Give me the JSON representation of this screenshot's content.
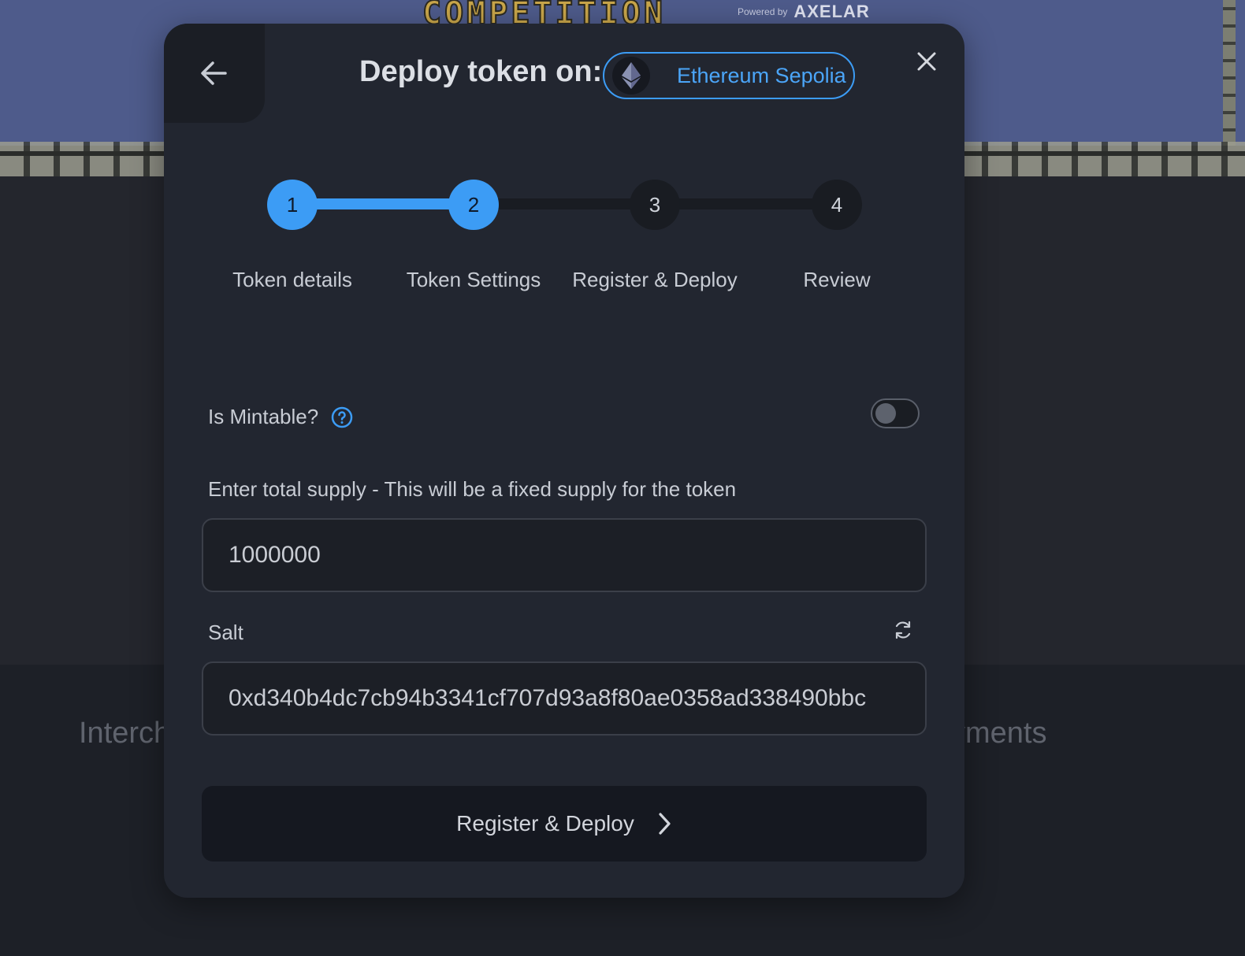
{
  "background": {
    "banner_title": "COMPETITION",
    "powered_by": "Powered by",
    "powered_brand": "AXELAR",
    "left_text": "Interch",
    "right_text": "yments"
  },
  "modal": {
    "title": "Deploy token on:",
    "chain": {
      "name": "Ethereum Sepolia",
      "icon": "ethereum-icon"
    },
    "steps": [
      {
        "number": "1",
        "label": "Token details",
        "state": "complete"
      },
      {
        "number": "2",
        "label": "Token Settings",
        "state": "current"
      },
      {
        "number": "3",
        "label": "Register & Deploy",
        "state": "pending"
      },
      {
        "number": "4",
        "label": "Review",
        "state": "pending"
      }
    ],
    "mintable": {
      "label": "Is Mintable?",
      "enabled": false
    },
    "supply": {
      "label": "Enter total supply - This will be a fixed supply for the token",
      "value": "1000000"
    },
    "salt": {
      "label": "Salt",
      "value": "0xd340b4dc7cb94b3341cf707d93a8f80ae0358ad338490bbc"
    },
    "submit_label": "Register & Deploy"
  },
  "colors": {
    "accent": "#3c9cf5",
    "modal_bg": "#222630",
    "page_bg": "#1d2027"
  }
}
